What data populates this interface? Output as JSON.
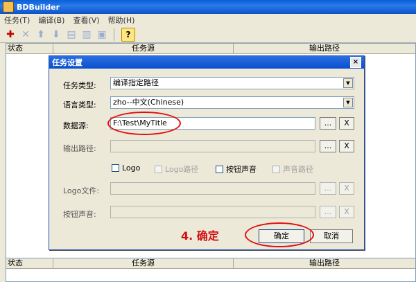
{
  "window": {
    "title": "BDBuilder"
  },
  "menu": [
    "任务(T)",
    "编译(B)",
    "查看(V)",
    "帮助(H)"
  ],
  "toolbar": {
    "help_glyph": "?"
  },
  "list": {
    "columns": [
      "状态",
      "任务源",
      "输出路径"
    ]
  },
  "dialog": {
    "title": "任务设置",
    "close_glyph": "×",
    "task_type": {
      "label": "任务类型:",
      "value": "编译指定路径"
    },
    "language": {
      "label": "语言类型:",
      "value": "zho--中文(Chinese)"
    },
    "source": {
      "label": "数据源:",
      "value": "F:\\Test\\MyTitle"
    },
    "output": {
      "label": "输出路径:",
      "value": ""
    },
    "browse_label": "...",
    "clear_label": "X",
    "checkboxes": [
      {
        "label": "Logo"
      },
      {
        "label": "Logo路径"
      },
      {
        "label": "按钮声音"
      },
      {
        "label": "声音路径"
      }
    ],
    "logo_file": {
      "label": "Logo文件:",
      "value": ""
    },
    "button_sound": {
      "label": "按钮声音:",
      "value": ""
    },
    "ok_label": "确定",
    "cancel_label": "取消"
  },
  "annotation": {
    "text": "4. 确定",
    "color": "#d01010"
  }
}
